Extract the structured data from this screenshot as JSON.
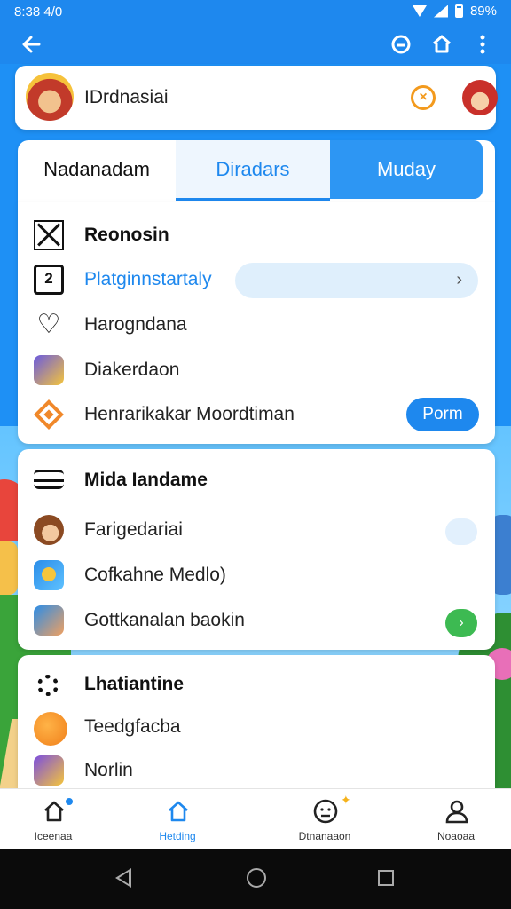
{
  "status_bar": {
    "time": "8:38 4/0",
    "battery": "89%"
  },
  "app_bar": {
    "back_icon": "arrow-left-icon",
    "actions": [
      "refresh-icon",
      "home-icon",
      "more-vert-icon"
    ]
  },
  "profile": {
    "name": "IDrdnasiai",
    "close_icon": "x-circle-icon"
  },
  "tabs": [
    {
      "label": "Nadanadam"
    },
    {
      "label": "Diradars"
    },
    {
      "label": "Muday"
    }
  ],
  "section1": {
    "items": [
      {
        "label": "Reonosin",
        "icon": "x-box-icon"
      },
      {
        "label": "Platginnstartaly",
        "icon": "number-2-icon"
      },
      {
        "label": "Harogndana",
        "icon": "heart-icon"
      },
      {
        "label": "Diakerdaon",
        "icon": "game-icon"
      },
      {
        "label": "Henrarikakar Moordtiman",
        "icon": "diamond-icon"
      }
    ],
    "form_button": "Porm"
  },
  "section2": {
    "items": [
      {
        "label": "Mida Iandame",
        "icon": "list-icon"
      },
      {
        "label": "Farigedariai",
        "icon": "avatar-icon"
      },
      {
        "label": "Cofkahne Medlo)",
        "icon": "app-icon"
      },
      {
        "label": "Gottkanalan baokin",
        "icon": "app-icon"
      }
    ]
  },
  "section3": {
    "items": [
      {
        "label": "Lhatiantine",
        "icon": "gear-icon"
      },
      {
        "label": "Teedgfacba",
        "icon": "orange-ball-icon"
      },
      {
        "label": "Norlin",
        "icon": "purple-app-icon"
      }
    ]
  },
  "bottom_nav": [
    {
      "label": "Iceenaa"
    },
    {
      "label": "Hetding"
    },
    {
      "label": "Dtnanaaon"
    },
    {
      "label": "Noaoaa"
    }
  ],
  "colors": {
    "primary": "#1e88ee",
    "accent": "#f39a1d",
    "green": "#3dba52"
  }
}
